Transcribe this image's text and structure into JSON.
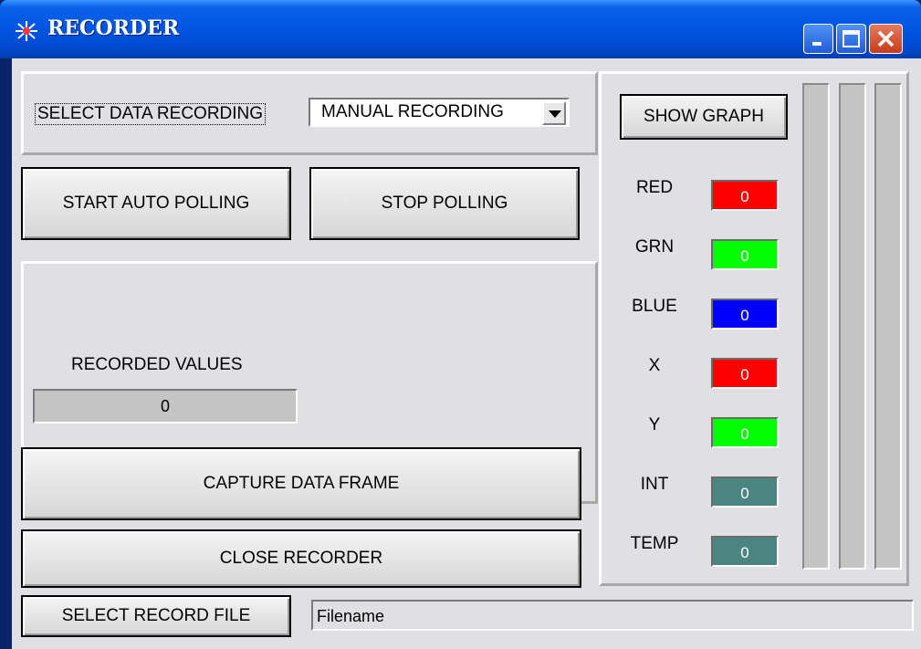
{
  "window": {
    "title": "RECORDER"
  },
  "recording": {
    "select_label": "SELECT DATA RECORDING",
    "selected_mode": "MANUAL RECORDING"
  },
  "buttons": {
    "start_auto_polling": "START AUTO POLLING",
    "stop_polling": "STOP POLLING",
    "capture_data_frame": "CAPTURE DATA FRAME",
    "close_recorder": "CLOSE RECORDER",
    "select_record_file": "SELECT RECORD FILE",
    "show_graph": "SHOW GRAPH"
  },
  "recorded": {
    "label": "RECORDED VALUES",
    "value": "0"
  },
  "channels": [
    {
      "label": "RED",
      "value": "0",
      "color": "#ff0000"
    },
    {
      "label": "GRN",
      "value": "0",
      "color": "#00ff00"
    },
    {
      "label": "BLUE",
      "value": "0",
      "color": "#0000ff"
    },
    {
      "label": "X",
      "value": "0",
      "color": "#ff0000"
    },
    {
      "label": "Y",
      "value": "0",
      "color": "#00ff00"
    },
    {
      "label": "INT",
      "value": "0",
      "color": "#4a8580"
    },
    {
      "label": "TEMP",
      "value": "0",
      "color": "#4a8580"
    }
  ],
  "file": {
    "filename": "Filename"
  }
}
